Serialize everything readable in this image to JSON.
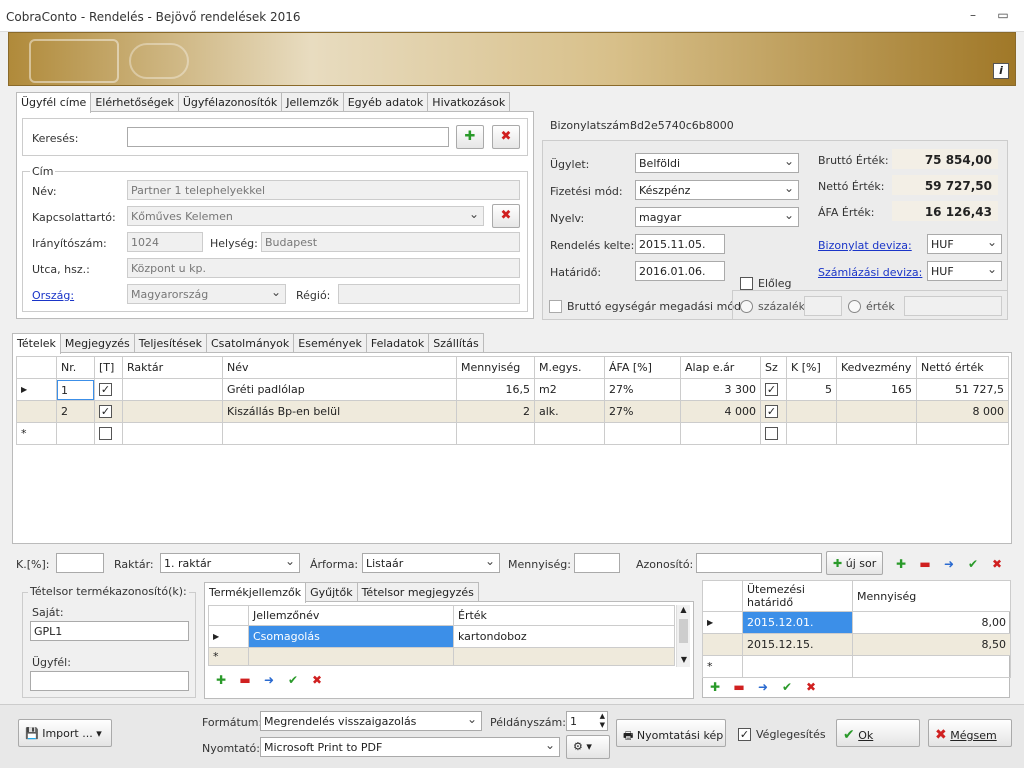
{
  "window": {
    "title": "CobraConto - Rendelés - Bejövő rendelések 2016",
    "minimize": "–",
    "restore": "▭"
  },
  "top_tabs": [
    "Ügyfél címe",
    "Elérhetőségek",
    "Ügyfélazonosítók",
    "Jellemzők",
    "Egyéb adatok",
    "Hivatkozások"
  ],
  "customer": {
    "search_label": "Keresés:",
    "search_value": "",
    "cim_legend": "Cím",
    "nev_label": "Név:",
    "nev_value": "Partner 1 telephelyekkel",
    "kapcs_label": "Kapcsolattartó:",
    "kapcs_value": "Kőműves Kelemen",
    "irsz_label": "Irányítószám:",
    "irsz_value": "1024",
    "helyseg_label": "Helység:",
    "helyseg_value": "Budapest",
    "utca_label": "Utca, hsz.:",
    "utca_value": "Központ u kp.",
    "orszag_label": "Ország:",
    "orszag_value": "Magyarország",
    "regio_label": "Régió:",
    "regio_value": ""
  },
  "doc": {
    "bizonylat_label": "Bizonylatszám:",
    "bizonylat_value": "8d2e5740c6b8000",
    "ugylet_label": "Ügylet:",
    "ugylet_value": "Belföldi",
    "fizetesi_label": "Fizetési mód:",
    "fizetesi_value": "Készpénz",
    "nyelv_label": "Nyelv:",
    "nyelv_value": "magyar",
    "kelte_label": "Rendelés kelte:",
    "kelte_value": "2015.11.05.",
    "hatarido_label": "Határidő:",
    "hatarido_value": "2016.01.06.",
    "brutto_label": "Bruttó Érték:",
    "brutto_value": "75 854,00",
    "netto_label": "Nettó Érték:",
    "netto_value": "59 727,50",
    "afa_label": "ÁFA Érték:",
    "afa_value": "16 126,43",
    "biz_deviza_label": "Bizonylat deviza:",
    "biz_deviza_value": "HUF",
    "szaml_deviza_label": "Számlázási deviza:",
    "szaml_deviza_value": "HUF",
    "eloleg_label": "Előleg",
    "brutto_mode_label": "Bruttó egységár megadási mód",
    "szazalek_label": "százalék",
    "ertek_label": "érték"
  },
  "mid_tabs": [
    "Tételek",
    "Megjegyzés",
    "Teljesítések",
    "Csatolmányok",
    "Események",
    "Feladatok",
    "Szállítás"
  ],
  "items": {
    "columns": [
      "",
      "Nr.",
      "[T]",
      "Raktár",
      "Név",
      "Mennyiség",
      "M.egys.",
      "ÁFA [%]",
      "Alap e.ár",
      "Sz",
      "K [%]",
      "Kedvezmény",
      "Nettó érték"
    ],
    "rows": [
      {
        "marker": "▶",
        "nr": "1",
        "t": "✓",
        "raktar": "",
        "nev": "Gréti padlólap",
        "menny": "16,5",
        "megys": "m2",
        "afa": "27%",
        "alap": "3 300",
        "sz": "✓",
        "k": "5",
        "kedv": "165",
        "netto": "51 727,5"
      },
      {
        "marker": "",
        "nr": "2",
        "t": "✓",
        "raktar": "",
        "nev": "Kiszállás Bp-en belül",
        "menny": "2",
        "megys": "alk.",
        "afa": "27%",
        "alap": "4 000",
        "sz": "✓",
        "k": "",
        "kedv": "",
        "netto": "8 000"
      },
      {
        "marker": "*",
        "nr": "",
        "t": "",
        "raktar": "",
        "nev": "",
        "menny": "",
        "megys": "",
        "afa": "",
        "alap": "",
        "sz": "",
        "k": "",
        "kedv": "",
        "netto": ""
      }
    ]
  },
  "itembar": {
    "k_label": "K.[%]:",
    "raktar_label": "Raktár:",
    "raktar_value": "1. raktár",
    "arforma_label": "Árforma:",
    "arforma_value": "Listaár",
    "menny_label": "Mennyiség:",
    "azon_label": "Azonosító:",
    "uj_sor_label": "új sor"
  },
  "termekazon": {
    "legend": "Tételsor termékazonosító(k):",
    "sajat_label": "Saját:",
    "sajat_value": "GPL1",
    "ugyfel_label": "Ügyfél:",
    "ugyfel_value": ""
  },
  "bottom_tabs": [
    "Termékjellemzők",
    "Gyűjtők",
    "Tételsor megjegyzés"
  ],
  "props": {
    "columns": [
      "",
      "Jellemzőnév",
      "Érték"
    ],
    "rows": [
      {
        "marker": "▶",
        "name": "Csomagolás",
        "value": "kartondoboz"
      },
      {
        "marker": "*",
        "name": "",
        "value": ""
      }
    ]
  },
  "schedule": {
    "columns": [
      "",
      "Ütemezési határidő",
      "Mennyiség"
    ],
    "rows": [
      {
        "marker": "▶",
        "date": "2015.12.01.",
        "qty": "8,00"
      },
      {
        "marker": "",
        "date": "2015.12.15.",
        "qty": "8,50"
      },
      {
        "marker": "*",
        "date": "",
        "qty": ""
      }
    ]
  },
  "footer": {
    "import_label": "Import ...",
    "formatum_label": "Formátum:",
    "formatum_value": "Megrendelés visszaigazolás",
    "peldany_label": "Példányszám:",
    "peldany_value": "1",
    "nyomtato_label": "Nyomtató:",
    "nyomtato_value": "Microsoft Print to PDF",
    "nyomtatasi_label": "Nyomtatási kép",
    "veglegesites_label": "Véglegesítés",
    "ok_label": "Ok",
    "megsem_label": "Mégsem"
  },
  "colors": {
    "accent_link": "#1a35c8",
    "selected": "#3c8fe8",
    "alt_row": "#efeadc",
    "value_bg": "#f3efe6"
  }
}
